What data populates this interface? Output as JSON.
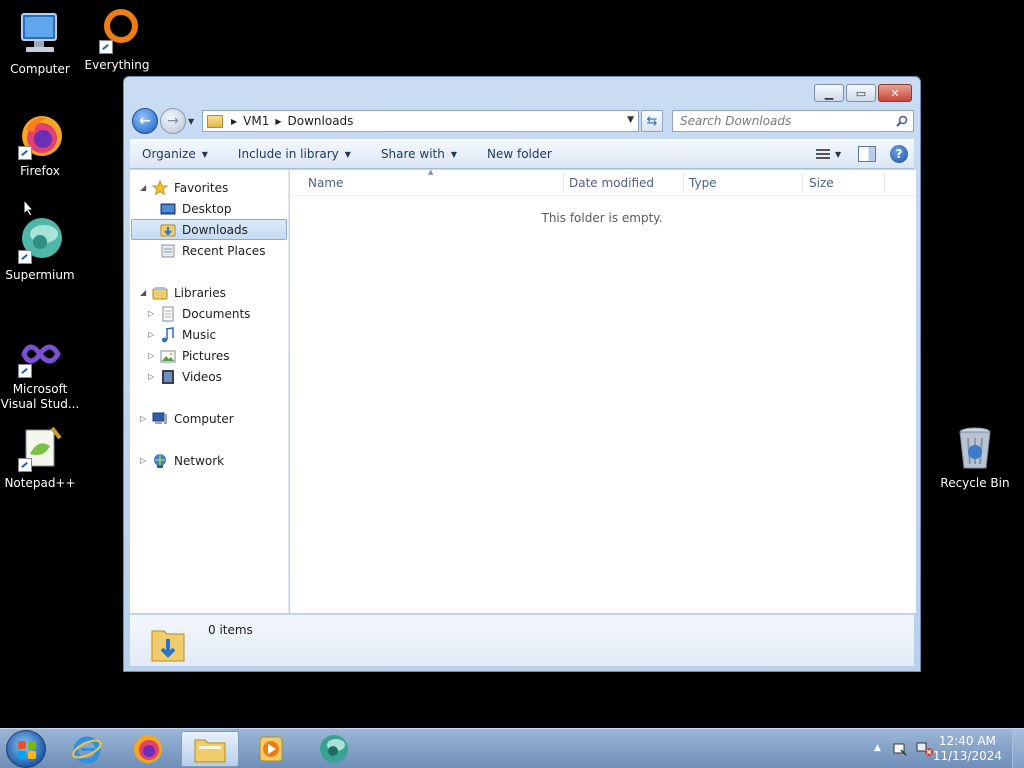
{
  "desktop": {
    "icons": [
      {
        "label": "Computer"
      },
      {
        "label": "Everything"
      },
      {
        "label": "Firefox"
      },
      {
        "label": "Supermium"
      },
      {
        "label": "Microsoft Visual Stud..."
      },
      {
        "label": "Notepad++"
      },
      {
        "label": "Recycle Bin"
      }
    ]
  },
  "explorer": {
    "breadcrumb": [
      "VM1",
      "Downloads"
    ],
    "search_placeholder": "Search Downloads",
    "toolbar": {
      "organize": "Organize",
      "include_in_library": "Include in library",
      "share_with": "Share with",
      "new_folder": "New folder"
    },
    "nav": {
      "favorites": "Favorites",
      "desktop": "Desktop",
      "downloads": "Downloads",
      "recent_places": "Recent Places",
      "libraries": "Libraries",
      "documents": "Documents",
      "music": "Music",
      "pictures": "Pictures",
      "videos": "Videos",
      "computer": "Computer",
      "network": "Network"
    },
    "columns": {
      "name": "Name",
      "date_modified": "Date modified",
      "type": "Type",
      "size": "Size"
    },
    "empty_message": "This folder is empty.",
    "status": "0 items"
  },
  "taskbar": {
    "clock_time": "12:40 AM",
    "clock_date": "11/13/2024"
  },
  "colors": {
    "selection": "#c4dcf5",
    "accent": "#1f5aa8"
  }
}
